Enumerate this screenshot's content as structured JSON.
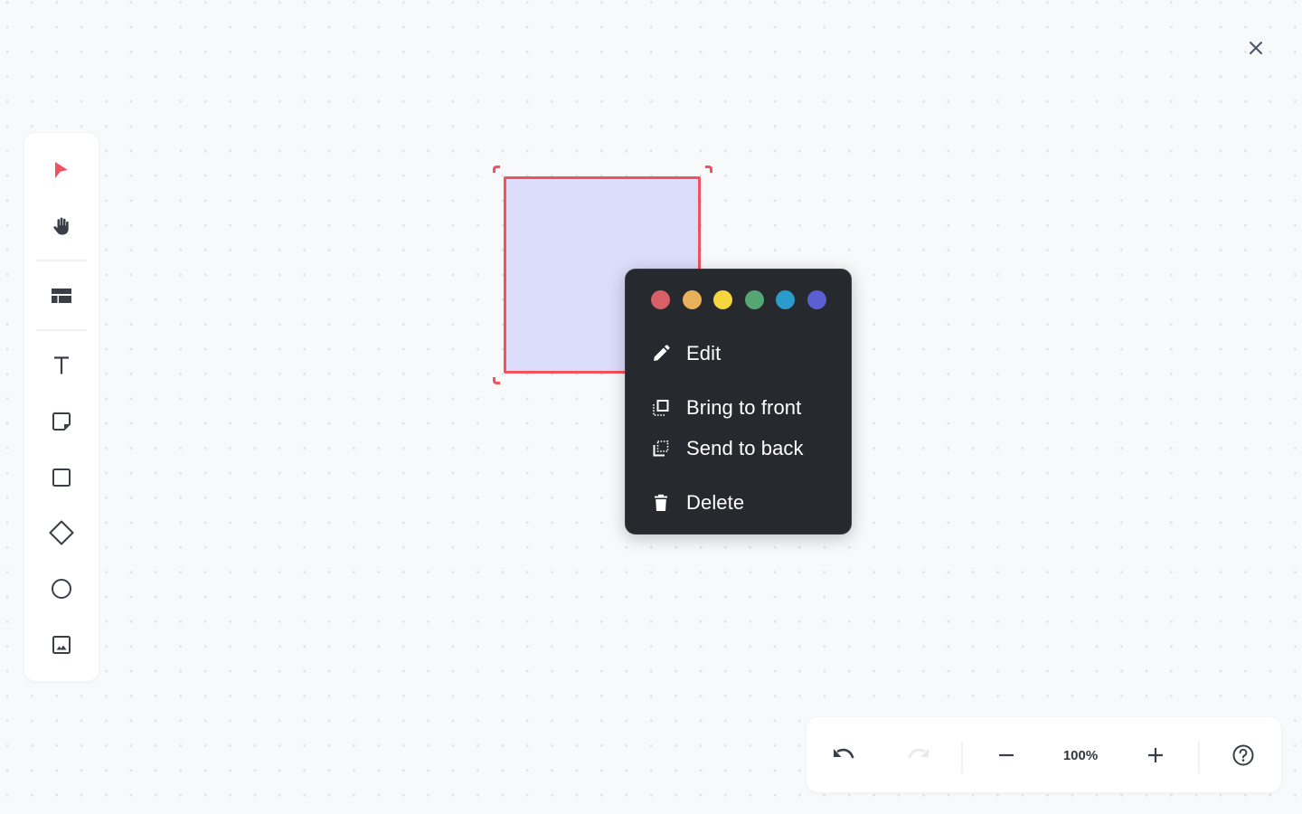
{
  "window": {
    "close_icon": "close-icon"
  },
  "toolbar": {
    "tools": [
      {
        "id": "select",
        "icon": "cursor-arrow-icon",
        "active": true
      },
      {
        "id": "hand",
        "icon": "hand-icon",
        "active": false
      },
      {
        "id": "template",
        "icon": "layout-template-icon",
        "active": false
      },
      {
        "id": "text",
        "icon": "text-icon",
        "active": false
      },
      {
        "id": "sticky-note",
        "icon": "sticky-note-icon",
        "active": false
      },
      {
        "id": "rectangle",
        "icon": "square-icon",
        "active": false
      },
      {
        "id": "diamond",
        "icon": "diamond-icon",
        "active": false
      },
      {
        "id": "ellipse",
        "icon": "circle-icon",
        "active": false
      },
      {
        "id": "image",
        "icon": "image-icon",
        "active": false
      }
    ],
    "active_color": "#f0525e"
  },
  "canvas": {
    "selected_shape": {
      "type": "rectangle",
      "fill": "#dcddfb",
      "stroke": "#f0525e"
    }
  },
  "context_menu": {
    "colors": [
      "#d95f66",
      "#e8b05a",
      "#f5d63d",
      "#55a672",
      "#2a9ccc",
      "#5b5fd2"
    ],
    "items": [
      {
        "label": "Edit",
        "icon": "pencil-icon"
      },
      {
        "label": "Bring to front",
        "icon": "bring-to-front-icon"
      },
      {
        "label": "Send to back",
        "icon": "send-to-back-icon"
      },
      {
        "label": "Delete",
        "icon": "trash-icon"
      }
    ]
  },
  "bottom_bar": {
    "undo_icon": "undo-icon",
    "redo_icon": "redo-icon",
    "zoom_out_icon": "minus-icon",
    "zoom_level": "100%",
    "zoom_in_icon": "plus-icon",
    "help_icon": "help-circle-icon"
  }
}
